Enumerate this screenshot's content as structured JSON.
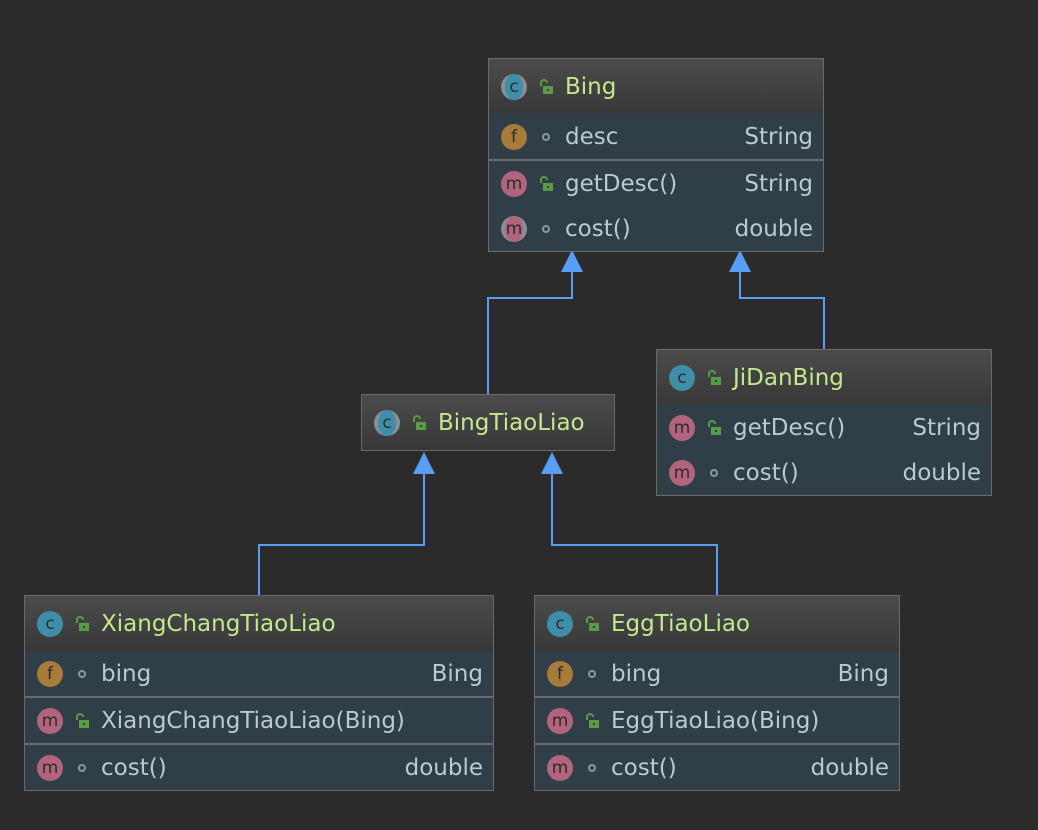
{
  "colors": {
    "background": "#2b2b2b",
    "edge": "#589df6",
    "class_title": "#c3e88d",
    "body": "#2f3e47"
  },
  "classes": [
    {
      "id": "bing",
      "name": "Bing",
      "kind": "abstract-class",
      "visibility": "public",
      "sections": [
        [
          {
            "kind": "field",
            "visibility": "package",
            "name": "desc",
            "type": "String"
          }
        ],
        [
          {
            "kind": "method",
            "visibility": "public",
            "name": "getDesc()",
            "type": "String"
          },
          {
            "kind": "abstract-method",
            "visibility": "package",
            "name": "cost()",
            "type": "double"
          }
        ]
      ]
    },
    {
      "id": "jidanbing",
      "name": "JiDanBing",
      "kind": "class",
      "visibility": "public",
      "sections": [
        [
          {
            "kind": "method",
            "visibility": "public",
            "name": "getDesc()",
            "type": "String"
          },
          {
            "kind": "method",
            "visibility": "package",
            "name": "cost()",
            "type": "double"
          }
        ]
      ]
    },
    {
      "id": "bingtiaoliao",
      "name": "BingTiaoLiao",
      "kind": "abstract-class",
      "visibility": "public",
      "sections": []
    },
    {
      "id": "xiangchangtiaoliao",
      "name": "XiangChangTiaoLiao",
      "kind": "class",
      "visibility": "public",
      "sections": [
        [
          {
            "kind": "field",
            "visibility": "package",
            "name": "bing",
            "type": "Bing"
          }
        ],
        [
          {
            "kind": "method",
            "visibility": "public",
            "name": "XiangChangTiaoLiao(Bing)",
            "type": ""
          }
        ],
        [
          {
            "kind": "method",
            "visibility": "package",
            "name": "cost()",
            "type": "double"
          }
        ]
      ]
    },
    {
      "id": "eggtiaoliao",
      "name": "EggTiaoLiao",
      "kind": "class",
      "visibility": "public",
      "sections": [
        [
          {
            "kind": "field",
            "visibility": "package",
            "name": "bing",
            "type": "Bing"
          }
        ],
        [
          {
            "kind": "method",
            "visibility": "public",
            "name": "EggTiaoLiao(Bing)",
            "type": ""
          }
        ],
        [
          {
            "kind": "method",
            "visibility": "package",
            "name": "cost()",
            "type": "double"
          }
        ]
      ]
    }
  ],
  "edges": [
    {
      "from": "bingtiaoliao",
      "to": "bing",
      "type": "extends"
    },
    {
      "from": "jidanbing",
      "to": "bing",
      "type": "extends"
    },
    {
      "from": "xiangchangtiaoliao",
      "to": "bingtiaoliao",
      "type": "extends"
    },
    {
      "from": "eggtiaoliao",
      "to": "bingtiaoliao",
      "type": "extends"
    }
  ]
}
